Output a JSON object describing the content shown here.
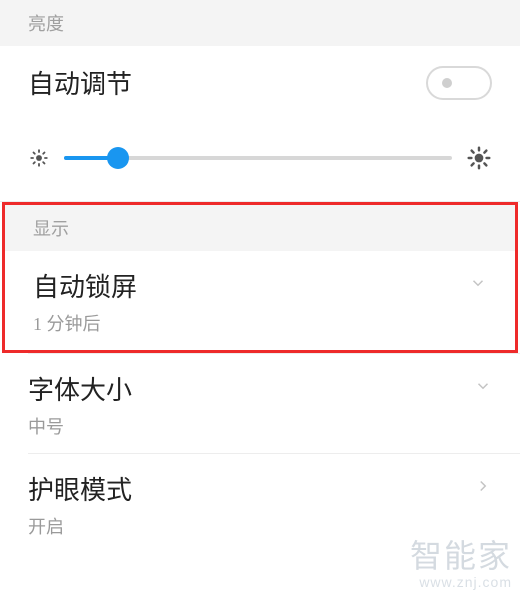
{
  "sections": {
    "brightness_header": "亮度",
    "display_header": "显示"
  },
  "auto_adjust": {
    "label": "自动调节",
    "enabled": false
  },
  "brightness_slider": {
    "percent": 14
  },
  "auto_lock": {
    "label": "自动锁屏",
    "value": "1 分钟后"
  },
  "font_size": {
    "label": "字体大小",
    "value": "中号"
  },
  "eye_care": {
    "label": "护眼模式",
    "value": "开启"
  },
  "watermark": {
    "title": "智能家",
    "url": "www.znj.com"
  }
}
